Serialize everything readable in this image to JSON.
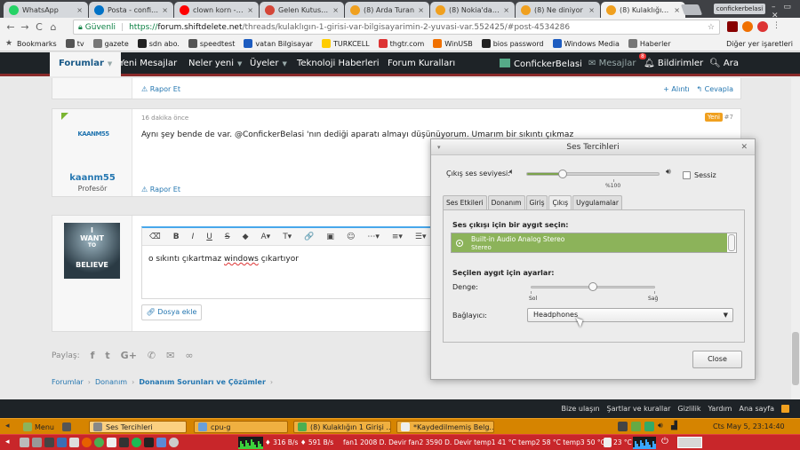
{
  "browser": {
    "tabs": [
      {
        "title": "WhatsApp",
        "color": "#25d366"
      },
      {
        "title": "Posta - conficke",
        "color": "#0072c6"
      },
      {
        "title": "clown korn - Ya",
        "color": "#ff0000"
      },
      {
        "title": "Gelen Kutusu (",
        "color": "#d44638"
      },
      {
        "title": "(8) Arda Turan",
        "color": "#f0a01f"
      },
      {
        "title": "(8) Nokia'dan A",
        "color": "#f0a01f"
      },
      {
        "title": "(8) Ne diniyor",
        "color": "#f0a01f"
      },
      {
        "title": "(8) Kulaklığın 1",
        "color": "#f0a01f"
      }
    ],
    "tab_close_glyph": "×",
    "profile_label": "confickerbelasi",
    "window_controls": "– ▭ ✕",
    "nav": {
      "back": "←",
      "forward": "→",
      "reload": "C",
      "home": "⌂"
    },
    "address": {
      "security": "Güvenli",
      "protocol": "https://",
      "host": "forum.shiftdelete.net",
      "path": "/threads/kulaklıgın-1-girisi-var-bilgisayarimin-2-yuvasi-var.552425/#post-4534286"
    },
    "bookmarks_label": "Bookmarks",
    "bookmarks": [
      {
        "label": "tv",
        "color": "#555"
      },
      {
        "label": "gazete",
        "color": "#777"
      },
      {
        "label": "sdn abo.",
        "color": "#222"
      },
      {
        "label": "speedtest",
        "color": "#555"
      },
      {
        "label": "vatan Bilgisayar",
        "color": "#1d5cc0"
      },
      {
        "label": "TURKCELL",
        "color": "#ffcc00"
      },
      {
        "label": "thgtr.com",
        "color": "#d33"
      },
      {
        "label": "WinUSB",
        "color": "#f07000"
      },
      {
        "label": "bios password",
        "color": "#222"
      },
      {
        "label": "Windows Media",
        "color": "#1d5cc0"
      },
      {
        "label": "Haberler",
        "color": "#777"
      }
    ],
    "other_bookmarks": "Diğer yer işaretleri"
  },
  "forum": {
    "nav": {
      "forums": "Forumlar",
      "new_messages": "Yeni Mesajlar",
      "whats_new": "Neler yeni",
      "members": "Üyeler",
      "tech_news": "Teknoloji Haberleri",
      "rules": "Forum Kuralları",
      "user": "ConfickerBelasi",
      "messages": "Mesajlar",
      "notifications": "Bildirimler",
      "notif_count": "8",
      "search": "Ara"
    },
    "post1": {
      "report": "Rapor Et",
      "quote": "+ Alıntı",
      "reply": "↰ Cevapla"
    },
    "post2": {
      "time": "16 dakika önce",
      "badge": "Yeni",
      "number": "#7",
      "avatar_text": "KAANM55",
      "username": "kaanm55",
      "user_title": "Profesör",
      "text": "Aynı şey bende de var. @ConfickerBelasi 'nın dediği aparatı almayı düşünüyorum. Umarım bir sıkıntı çıkmaz",
      "report": "Rapor Et"
    },
    "reply_box": {
      "avatar_lines": [
        "I",
        "WANT",
        "TO",
        "BELIEVE"
      ],
      "toolbar": [
        "⌫",
        "B",
        "I",
        "U",
        "S",
        "◆",
        "A▾",
        "T▾",
        "🔗",
        "▣",
        "☺",
        "⋯▾",
        "≡▾",
        "☰▾"
      ],
      "text_before": "o sıkıntı çıkartmaz ",
      "text_misspelled": "windows",
      "text_after": " çıkartıyor",
      "attach": "Dosya ekle"
    },
    "share_label": "Paylaş:",
    "share_icons": [
      "f",
      "t",
      "G+",
      "✆",
      "✉",
      "∞"
    ],
    "breadcrumb": [
      "Forumlar",
      "Donanım",
      "Donanım Sorunları ve Çözümler"
    ],
    "footer_links": [
      "Bize ulaşın",
      "Şartlar ve kurallar",
      "Gizlilik",
      "Yardım",
      "Ana sayfa"
    ]
  },
  "sound_dialog": {
    "title": "Ses Tercihleri",
    "menu_glyph": "▾",
    "close_glyph": "✕",
    "output_volume_label": "Çıkış ses seviyesi:",
    "volume_percent_label": "%100",
    "volume_level": 0.27,
    "mute_label": "Sessiz",
    "mute_checked": false,
    "tabs": [
      "Ses Etkileri",
      "Donanım",
      "Giriş",
      "Çıkış",
      "Uygulamalar"
    ],
    "active_tab": "Çıkış",
    "choose_device_label": "Ses çıkışı için bir aygıt seçin:",
    "device": {
      "name": "Built-in Audio Analog Stereo",
      "subtitle": "Stereo"
    },
    "settings_label": "Seçilen aygıt için ayarlar:",
    "balance_label": "Denge:",
    "balance_left": "Sol",
    "balance_right": "Sağ",
    "balance_level": 0.5,
    "connector_label": "Bağlayıcı:",
    "connector_value": "Headphones",
    "close_button": "Close"
  },
  "taskbar": {
    "menu_label": "Menu",
    "tasks": [
      {
        "label": "Ses Tercihleri",
        "active": true
      },
      {
        "label": "cpu-g",
        "active": false
      },
      {
        "label": "(8) Kulaklığın 1 Girişi ...",
        "active": false
      },
      {
        "label": "*Kaydedilmemiş Belg...",
        "active": false
      }
    ],
    "clock": "Cts May  5, 23:14:40",
    "net_text": "♦ 316 B/s ♦ 591 B/s",
    "sensors_text": "fan1 2008 D. Devir fan2 3590 D. Devir temp1 41 °C temp2 58 °C temp3 50 °C",
    "temp_text": "23 °C"
  },
  "colors": {
    "forum_nav_bg": "#1e2327",
    "link_blue": "#2577b1",
    "device_selected": "#8cb35a",
    "taskbar_top": "#d68400",
    "taskbar_bottom": "#c8262a"
  }
}
